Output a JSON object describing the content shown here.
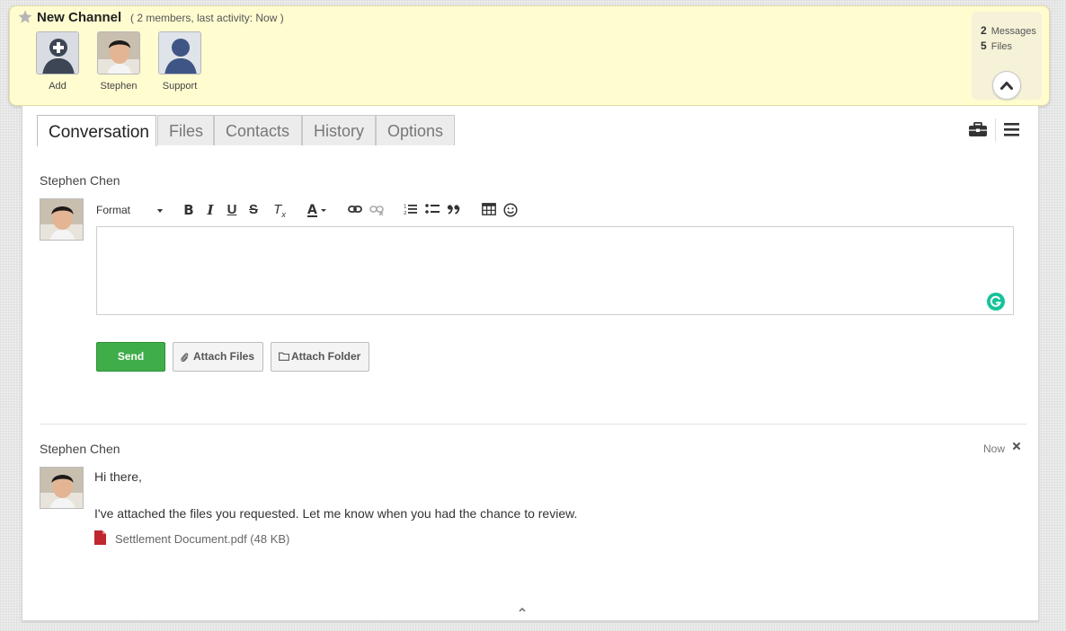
{
  "header": {
    "title": "New Channel",
    "meta": "( 2 members, last activity: Now )",
    "members": [
      {
        "label": "Add"
      },
      {
        "label": "Stephen"
      },
      {
        "label": "Support"
      }
    ],
    "stats": {
      "messages_count": "2",
      "messages_label": "Messages",
      "files_count": "5",
      "files_label": "Files"
    }
  },
  "tabs": [
    {
      "label": "Conversation",
      "active": true
    },
    {
      "label": "Files"
    },
    {
      "label": "Contacts"
    },
    {
      "label": "History"
    },
    {
      "label": "Options"
    }
  ],
  "composer": {
    "author": "Stephen Chen",
    "format_label": "Format",
    "editor_value": "",
    "send_label": "Send",
    "attach_files_label": "Attach Files",
    "attach_folder_label": "Attach Folder"
  },
  "message": {
    "author": "Stephen Chen",
    "time": "Now",
    "line1": "Hi there,",
    "line2": "I've attached the files you requested. Let me know when you had the chance to review.",
    "attachment": "Settlement Document.pdf (48 KB)"
  },
  "colors": {
    "header_bg": "#fffcd0",
    "send_green": "#3fae49",
    "pdf_red": "#c0262d",
    "grammarly_green": "#15c39a"
  }
}
